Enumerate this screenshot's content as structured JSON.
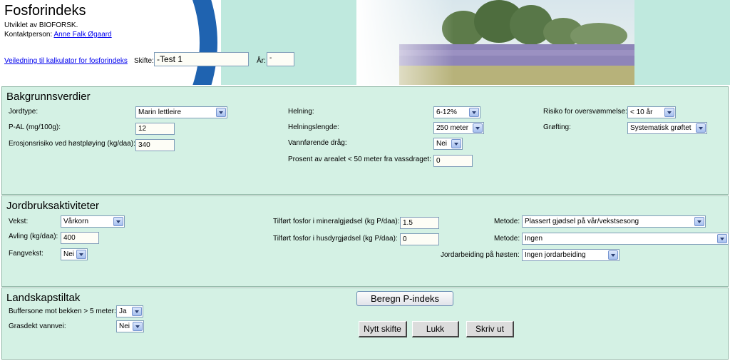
{
  "header": {
    "title": "Fosforindeks",
    "developed_by": "Utviklet av BIOFORSK.",
    "contact_label": "Kontaktperson:",
    "contact_name": "Anne Falk Øgaard",
    "guide_link": "Veiledning til kalkulator for fosforindeks",
    "field_label": "Skifte:",
    "field_value": "-Test 1",
    "year_label": "År:",
    "year_value": "-"
  },
  "background": {
    "title": "Bakgrunnsverdier",
    "soil_type_label": "Jordtype:",
    "soil_type_value": "Marin lettleire",
    "pal_label": "P-AL (mg/100g):",
    "pal_value": "12",
    "erosion_label": "Erosjonsrisiko ved høstpløying (kg/daa):",
    "erosion_value": "340",
    "slope_label": "Helning:",
    "slope_value": "6-12%",
    "slope_length_label": "Helningslengde:",
    "slope_length_value": "250 meter",
    "waterways_label": "Vannførende dråg:",
    "waterways_value": "Nei",
    "percent_area_label": "Prosent av arealet < 50 meter fra vassdraget:",
    "percent_area_value": "0",
    "flood_label": "Risiko for oversvømmelse:",
    "flood_value": "< 10 år",
    "drainage_label": "Grøfting:",
    "drainage_value": "Systematisk grøftet"
  },
  "activities": {
    "title": "Jordbruksaktiviteter",
    "crop_label": "Vekst:",
    "crop_value": "Vårkorn",
    "yield_label": "Avling (kg/daa):",
    "yield_value": "400",
    "catch_crop_label": "Fangvekst:",
    "catch_crop_value": "Nei",
    "mineral_p_label": "Tilført fosfor i mineralgjødsel (kg P/daa):",
    "mineral_p_value": "1.5",
    "manure_p_label": "Tilført fosfor i husdyrgjødsel (kg P/daa):",
    "manure_p_value": "0",
    "method1_label": "Metode:",
    "method1_value": "Plassert gjødsel på vår/vekstsesong",
    "method2_label": "Metode:",
    "method2_value": "Ingen",
    "autumn_tillage_label": "Jordarbeiding på høsten:",
    "autumn_tillage_value": "Ingen jordarbeiding"
  },
  "landscape": {
    "title": "Landskapstiltak",
    "buffer_label": "Buffersone mot bekken > 5 meter:",
    "buffer_value": "Ja",
    "grassed_label": "Grasdekt vannvei:",
    "grassed_value": "Nei",
    "calc_button": "Beregn P-indeks",
    "new_button": "Nytt skifte",
    "close_button": "Lukk",
    "print_button": "Skriv ut"
  }
}
